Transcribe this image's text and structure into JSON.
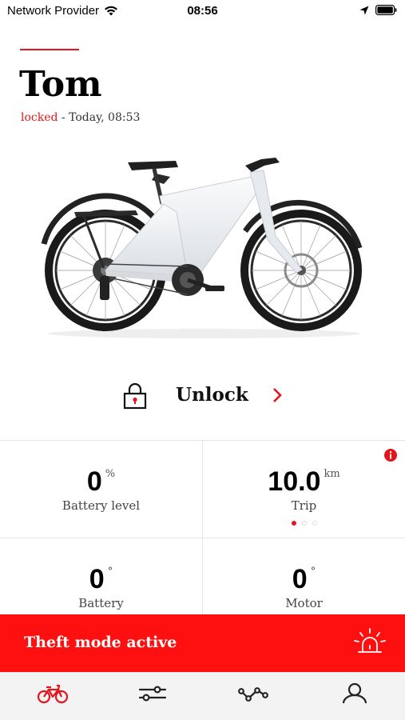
{
  "status_bar": {
    "carrier": "Network Provider",
    "time": "08:56",
    "icons": [
      "wifi-icon",
      "location-arrow-icon",
      "battery-icon"
    ]
  },
  "bike": {
    "name": "Tom",
    "lock_state": "locked",
    "last_update": " - Today, 08:53",
    "image": "e-bike-photo"
  },
  "unlock": {
    "label": "Unlock",
    "icon": "padlock-icon",
    "chevron": "chevron-right-icon"
  },
  "stats": [
    {
      "value": "0",
      "unit": "%",
      "label": "Battery level"
    },
    {
      "value": "10.0",
      "unit": "km",
      "label": "Trip",
      "pager": {
        "count": 3,
        "active": 0
      },
      "badge": "info-icon"
    },
    {
      "value": "0",
      "unit": "°",
      "label": "Battery"
    },
    {
      "value": "0",
      "unit": "°",
      "label": "Motor"
    }
  ],
  "theft": {
    "label": "Theft mode active",
    "icon": "alarm-siren-icon"
  },
  "nav": {
    "items": [
      {
        "name": "bike",
        "icon": "bicycle-icon",
        "active": true
      },
      {
        "name": "settings",
        "icon": "sliders-icon",
        "active": false
      },
      {
        "name": "rides",
        "icon": "route-icon",
        "active": false
      },
      {
        "name": "profile",
        "icon": "user-icon",
        "active": false
      }
    ]
  },
  "colors": {
    "accent": "#e3141b",
    "banner": "#ff1010",
    "nav_bg": "#f3f3f3"
  }
}
